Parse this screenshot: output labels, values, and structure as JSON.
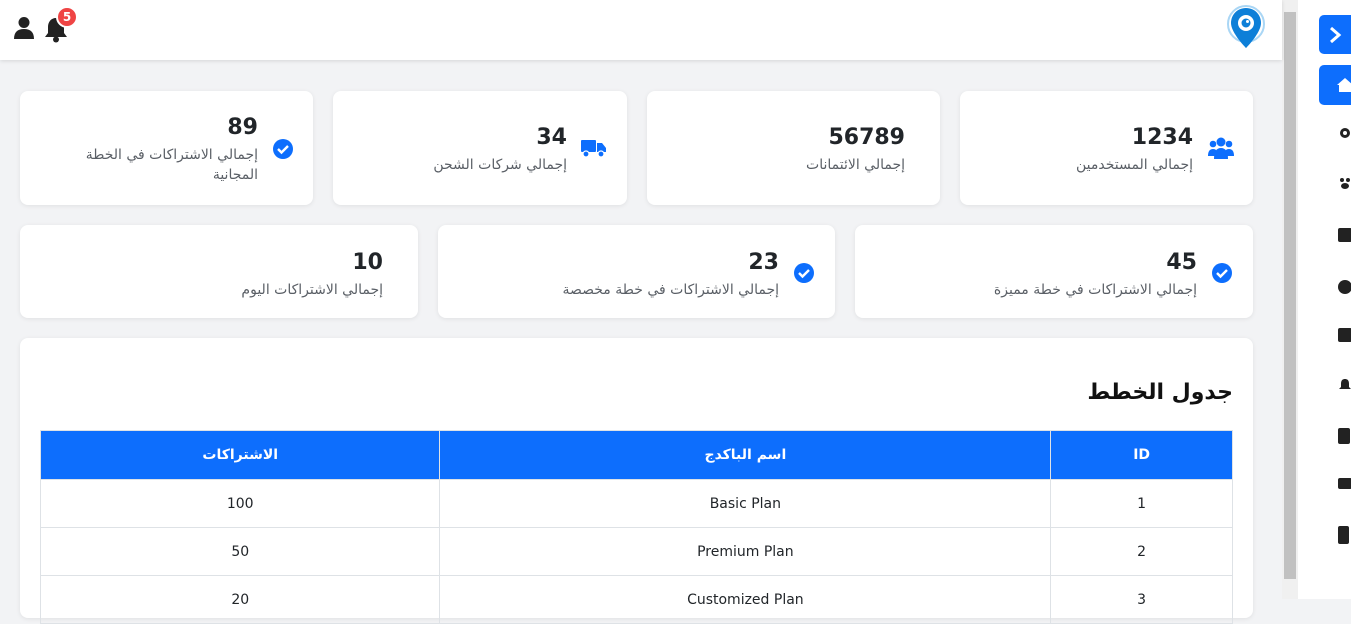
{
  "header": {
    "notification_count": "5"
  },
  "stats": [
    {
      "value": "1234",
      "label": "إجمالي المستخدمين",
      "icon": "users-icon"
    },
    {
      "value": "56789",
      "label": "إجمالي الائتمانات",
      "icon": ""
    },
    {
      "value": "34",
      "label": "إجمالي شركات الشحن",
      "icon": "truck-icon"
    },
    {
      "value": "89",
      "label": "إجمالي الاشتراكات في الخطة المجانية",
      "icon": "check-circle-icon"
    },
    {
      "value": "45",
      "label": "إجمالي الاشتراكات في خطة مميزة",
      "icon": "check-circle-icon"
    },
    {
      "value": "23",
      "label": "إجمالي الاشتراكات في خطة مخصصة",
      "icon": "check-circle-icon"
    },
    {
      "value": "10",
      "label": "إجمالي الاشتراكات اليوم",
      "icon": ""
    }
  ],
  "plans_table": {
    "title": "جدول الخطط",
    "columns": [
      "ID",
      "اسم الباكدج",
      "الاشتراكات"
    ],
    "rows": [
      {
        "id": "1",
        "name": "Basic Plan",
        "subscriptions": "100"
      },
      {
        "id": "2",
        "name": "Premium Plan",
        "subscriptions": "50"
      },
      {
        "id": "3",
        "name": "Customized Plan",
        "subscriptions": "20"
      }
    ]
  },
  "colors": {
    "accent": "#0d6efd",
    "badge": "#ef4444",
    "background": "#f2f3f5"
  },
  "sidebar_icons": [
    "chevron-right-icon",
    "home-icon",
    "gear-icon",
    "paw-icon",
    "id-card-icon",
    "tag-icon",
    "contact-card-icon",
    "bell-icon",
    "clipboard-icon",
    "envelope-icon",
    "book-icon"
  ]
}
